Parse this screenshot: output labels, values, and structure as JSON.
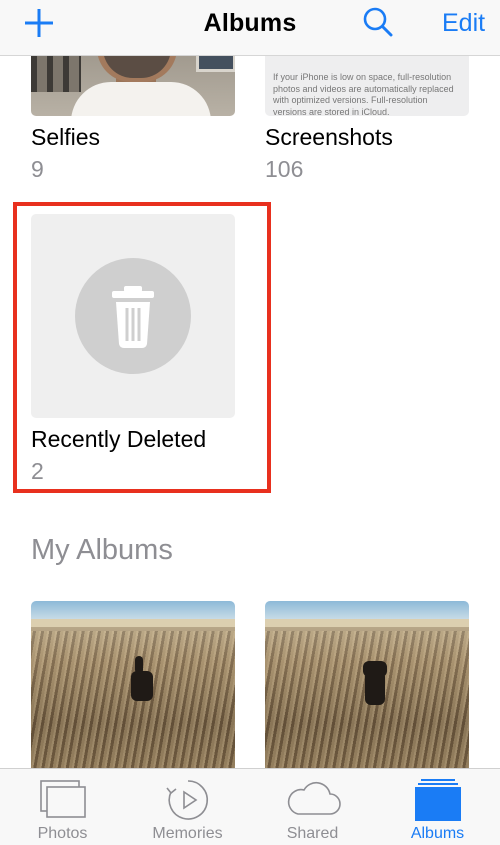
{
  "navbar": {
    "title": "Albums",
    "edit_label": "Edit",
    "add_icon": "plus-icon",
    "search_icon": "search-icon",
    "accent": "#1a7cf5"
  },
  "albums": [
    {
      "title": "Selfies",
      "count": "9"
    },
    {
      "title": "Screenshots",
      "count": "106",
      "thumb_text": "If your iPhone is low on space, full-resolution photos and videos are automatically replaced with optimized versions. Full-resolution versions are stored in iCloud."
    },
    {
      "title": "Recently Deleted",
      "count": "2",
      "icon": "trash-icon"
    }
  ],
  "my_albums": {
    "section_title": "My Albums"
  },
  "highlight_color": "#e8301e",
  "tabbar": {
    "tabs": [
      {
        "label": "Photos",
        "icon": "photos-icon",
        "active": false
      },
      {
        "label": "Memories",
        "icon": "memories-icon",
        "active": false
      },
      {
        "label": "Shared",
        "icon": "cloud-icon",
        "active": false
      },
      {
        "label": "Albums",
        "icon": "albums-icon",
        "active": true
      }
    ]
  }
}
